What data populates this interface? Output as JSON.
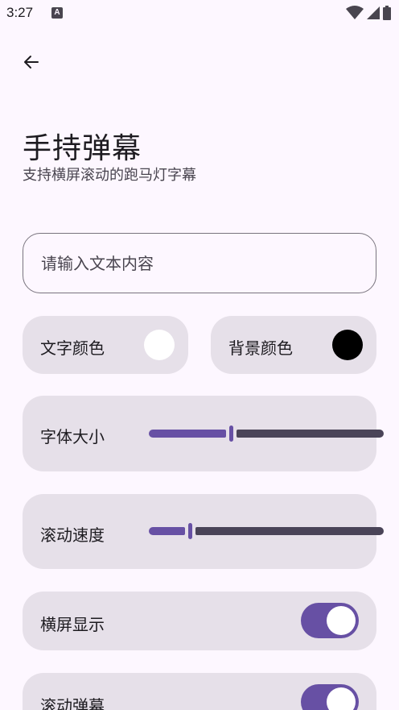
{
  "status_bar": {
    "time": "3:27",
    "notification_glyph": "A"
  },
  "header": {
    "title": "手持弹幕",
    "subtitle": "支持横屏滚动的跑马灯字幕"
  },
  "input": {
    "placeholder": "请输入文本内容",
    "value": ""
  },
  "colors": {
    "text_color_label": "文字颜色",
    "text_color_value": "#ffffff",
    "bg_color_label": "背景颜色",
    "bg_color_value": "#000000",
    "accent": "#6750a4"
  },
  "font_size": {
    "label": "字体大小",
    "value_fraction": 0.35
  },
  "scroll_speed": {
    "label": "滚动速度",
    "value_fraction": 0.17
  },
  "landscape": {
    "label": "横屏显示",
    "on": true
  },
  "scroll": {
    "label": "滚动弹幕",
    "on": true
  }
}
